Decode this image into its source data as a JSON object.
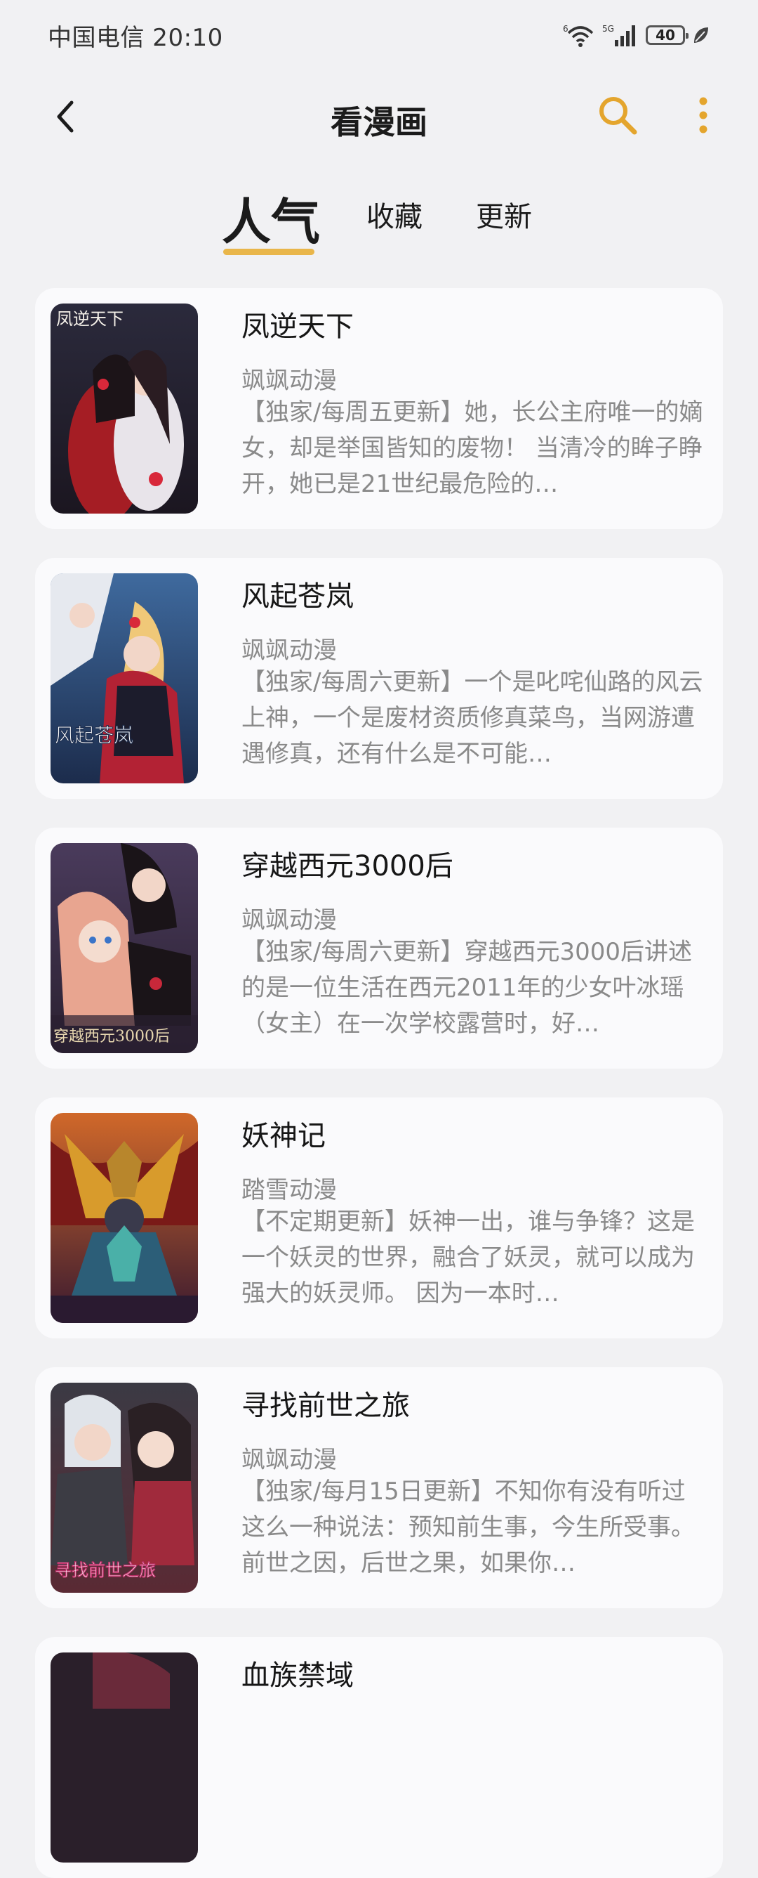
{
  "status_bar": {
    "carrier_time": "中国电信 20:10",
    "wifi_label": "6",
    "signal_label": "5G",
    "battery": "40"
  },
  "header": {
    "title": "看漫画",
    "accent_color": "#e4a52d"
  },
  "tabs": [
    {
      "label": "人气",
      "active": true
    },
    {
      "label": "收藏",
      "active": false
    },
    {
      "label": "更新",
      "active": false
    }
  ],
  "comics": [
    {
      "title": "凤逆天下",
      "author": "飒飒动漫",
      "description": "【独家/每周五更新】她，长公主府唯一的嫡女，却是举国皆知的废物！ 当清冷的眸子睁开，她已是21世纪最危险的…",
      "cover_text": "凤逆天下",
      "cover_colors": [
        "#2b2a3c",
        "#a51d24"
      ]
    },
    {
      "title": "风起苍岚",
      "author": "飒飒动漫",
      "description": "【独家/每周六更新】一个是叱咤仙路的风云上神，一个是废材资质修真菜鸟，当网游遭遇修真，还有什么是不可能…",
      "cover_text": "风起苍岚",
      "cover_colors": [
        "#3f6a9e",
        "#b32234"
      ]
    },
    {
      "title": "穿越西元3000后",
      "author": "飒飒动漫",
      "description": "【独家/每周六更新】穿越西元3000后讲述的是一位生活在西元2011年的少女叶冰瑶（女主）在一次学校露营时，好…",
      "cover_text": "穿越西元3000后",
      "cover_colors": [
        "#4a3b5c",
        "#d8867a"
      ]
    },
    {
      "title": "妖神记",
      "author": "踏雪动漫",
      "description": "【不定期更新】妖神一出，谁与争锋？这是一个妖灵的世界，融合了妖灵，就可以成为强大的妖灵师。 因为一本时…",
      "cover_text": "",
      "cover_colors": [
        "#7a1a18",
        "#d89b2c"
      ]
    },
    {
      "title": "寻找前世之旅",
      "author": "飒飒动漫",
      "description": "【独家/每月15日更新】不知你有没有听过这么一种说法：预知前生事，今生所受事。前世之因，后世之果，如果你…",
      "cover_text": "寻找前世之旅",
      "cover_colors": [
        "#3b3a44",
        "#a02a3c"
      ]
    },
    {
      "title": "血族禁域",
      "author": "",
      "description": "",
      "cover_text": "",
      "cover_colors": [
        "#2a1f2a",
        "#6a2a3a"
      ]
    }
  ]
}
